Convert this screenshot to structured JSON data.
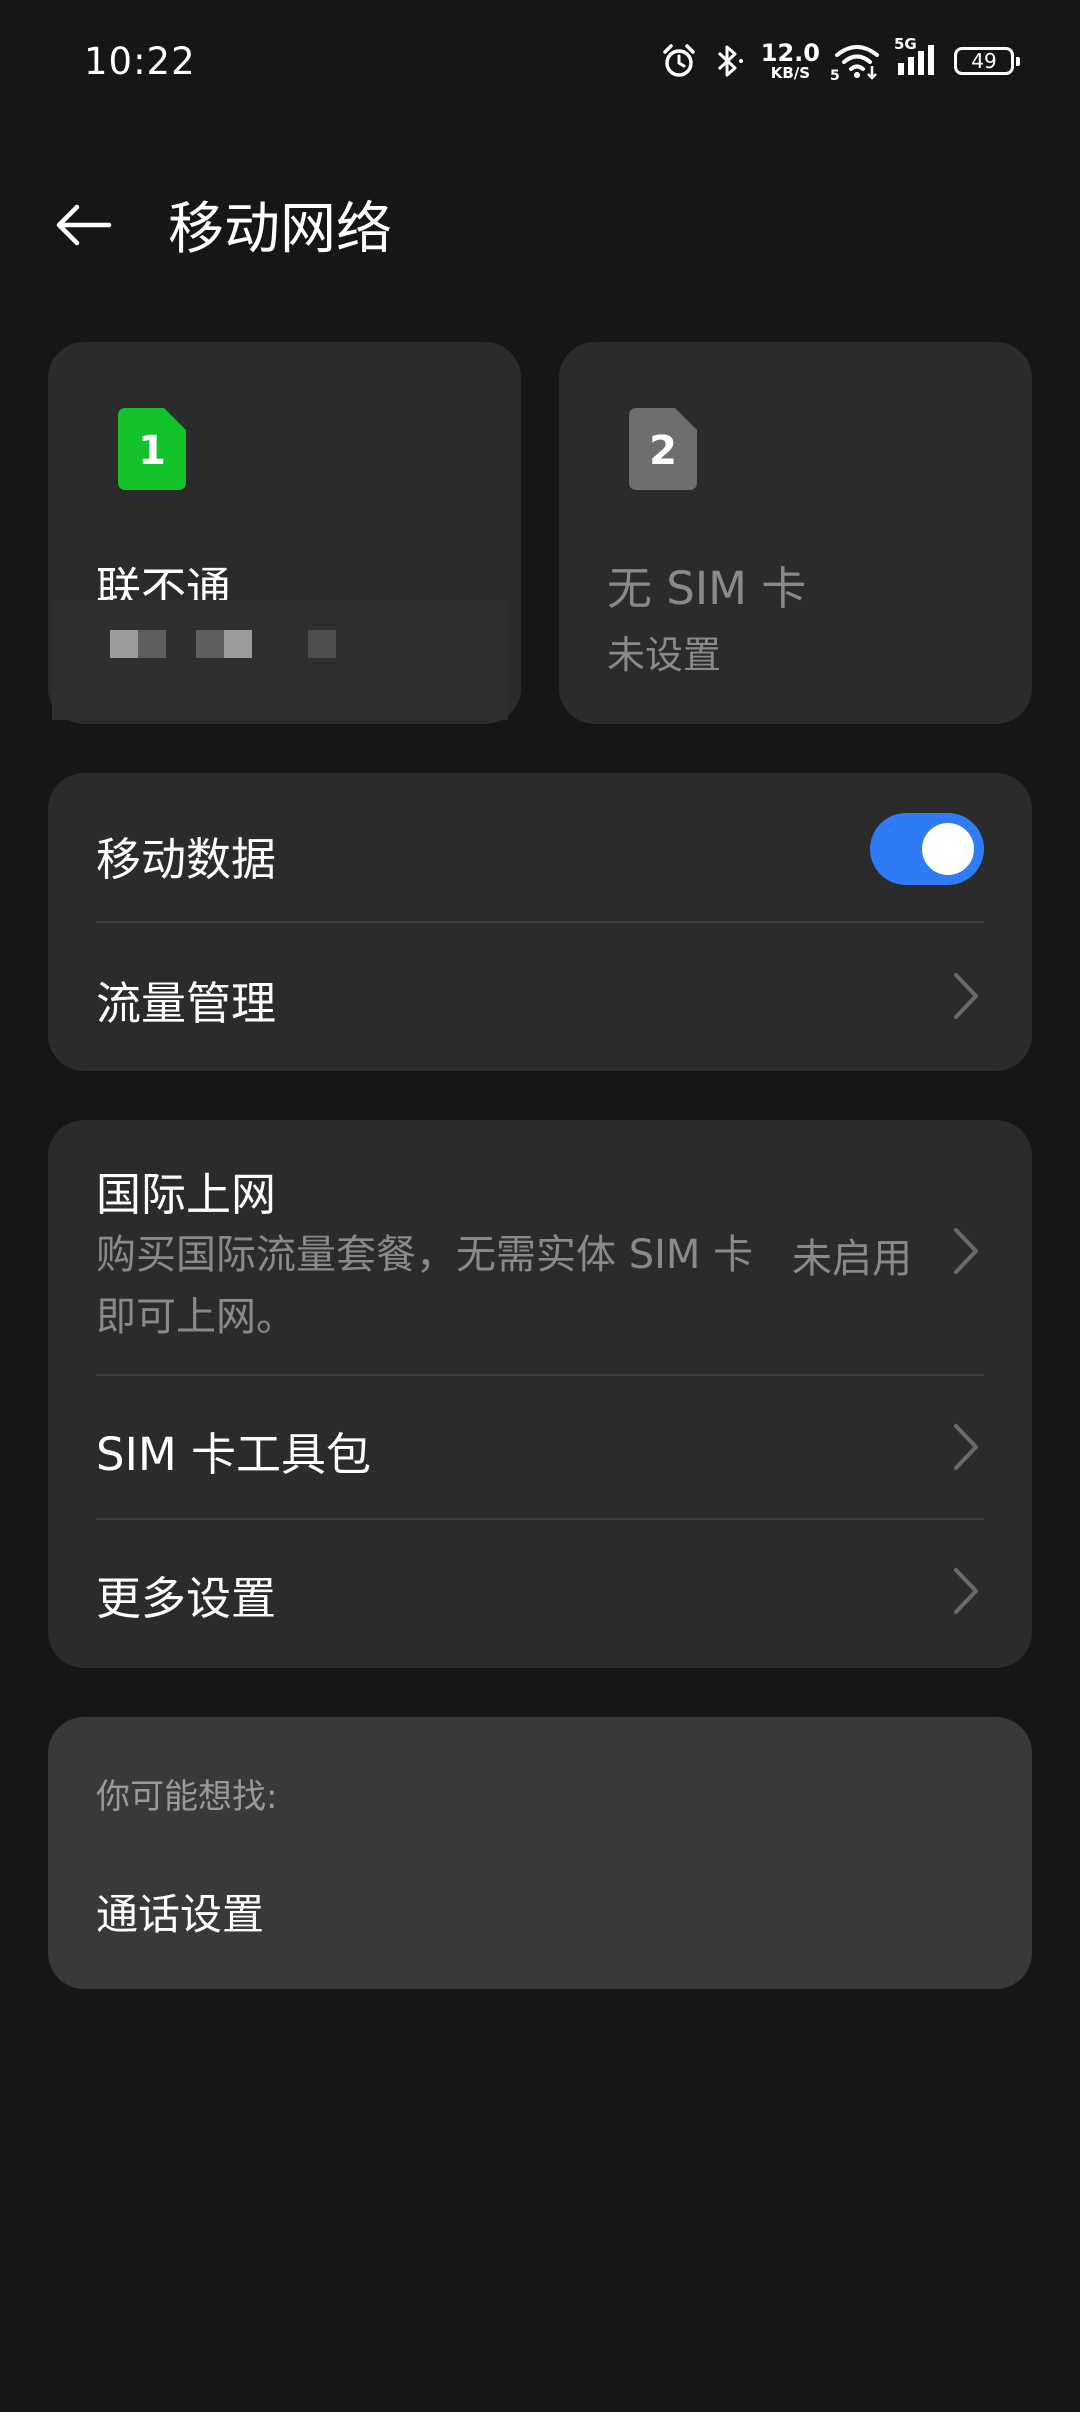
{
  "status_bar": {
    "time": "10:22",
    "net_speed_value": "12.0",
    "net_speed_unit": "KB/S",
    "signal_label": "5G",
    "wifi_badge": "5",
    "battery": "49"
  },
  "header": {
    "title": "移动网络"
  },
  "sims": [
    {
      "slot": "1",
      "name": "联不通",
      "color": "#12c22b"
    },
    {
      "slot": "2",
      "name": "无 SIM 卡",
      "sub": "未设置",
      "color": "#6e6e6e"
    }
  ],
  "data_group": {
    "mobile_data_label": "移动数据",
    "mobile_data_enabled": true,
    "traffic_label": "流量管理"
  },
  "settings_group": {
    "intl_label": "国际上网",
    "intl_desc": "购买国际流量套餐，无需实体 SIM 卡即可上网。",
    "intl_status": "未启用",
    "toolkit_label": "SIM 卡工具包",
    "more_label": "更多设置"
  },
  "suggest": {
    "title": "你可能想找:",
    "item": "通话设置"
  },
  "colors": {
    "accent": "#2f7cf6",
    "background": "#161616",
    "card": "#2b2b2b"
  }
}
